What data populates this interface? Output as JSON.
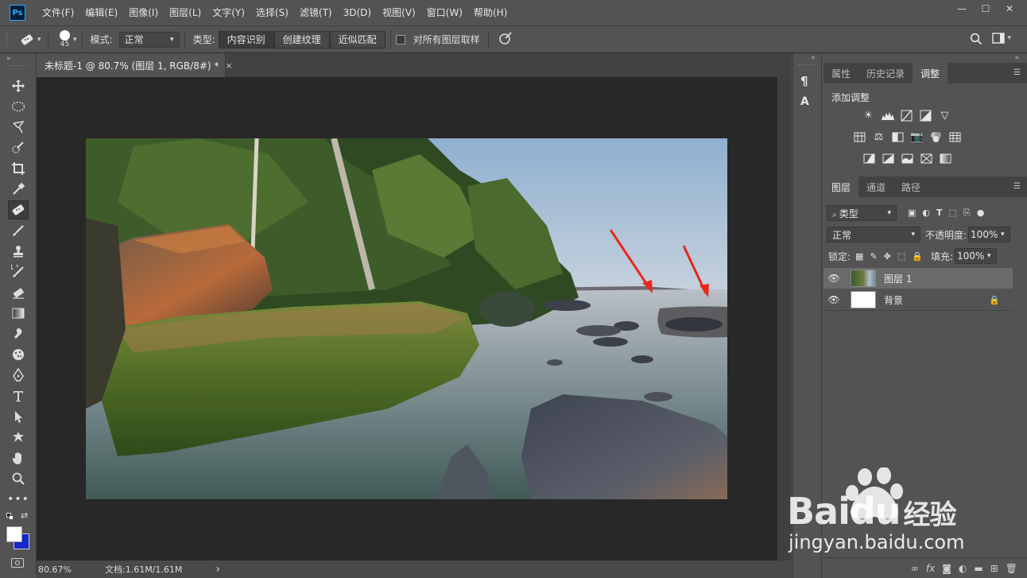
{
  "app": {
    "logo": "Ps"
  },
  "menu": [
    "文件(F)",
    "编辑(E)",
    "图像(I)",
    "图层(L)",
    "文字(Y)",
    "选择(S)",
    "滤镜(T)",
    "3D(D)",
    "视图(V)",
    "窗口(W)",
    "帮助(H)"
  ],
  "window_controls": [
    "minimize-icon",
    "maximize-icon",
    "close-icon"
  ],
  "options": {
    "brush_size": "45",
    "mode_label": "模式:",
    "mode_value": "正常",
    "type_label": "类型:",
    "type_buttons": [
      "内容识别",
      "创建纹理",
      "近似匹配"
    ],
    "sample_all_label": "对所有图层取样"
  },
  "document": {
    "tab_title": "未标题-1 @ 80.7% (图层 1, RGB/8#) *",
    "close": "×"
  },
  "status": {
    "zoom": "80.67%",
    "doc_info": "文档:1.61M/1.61M",
    "arrow": "›"
  },
  "adjust_panel": {
    "tabs": [
      "属性",
      "历史记录",
      "调整"
    ],
    "active_tab": "调整",
    "title": "添加调整"
  },
  "layers_panel": {
    "tabs": [
      "图层",
      "通道",
      "路径"
    ],
    "active_tab": "图层",
    "filter_label": "类型",
    "blend_mode": "正常",
    "opacity_label": "不透明度:",
    "opacity_value": "100%",
    "lock_label": "锁定:",
    "fill_label": "填充:",
    "fill_value": "100%",
    "layers": [
      {
        "name": "图层 1",
        "visible": true,
        "selected": true
      },
      {
        "name": "背景",
        "visible": true,
        "locked": true
      }
    ]
  },
  "watermark": {
    "brand": "Baidu",
    "brand_cn": "经验",
    "url": "jingyan.baidu.com"
  },
  "colors": {
    "accent": "#31a8ff",
    "foreground": "#ffffff",
    "background": "#1428c8",
    "arrow_red": "#e8281e"
  }
}
